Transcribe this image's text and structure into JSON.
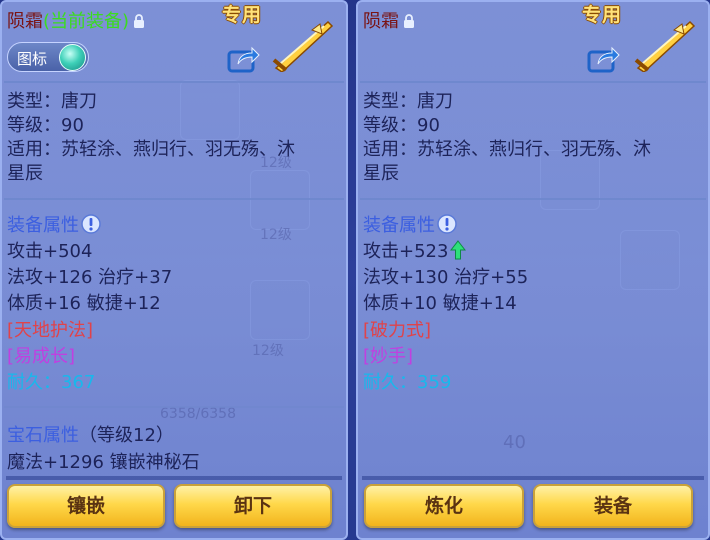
{
  "left_panel": {
    "name": "陨霜",
    "name_suffix": "(当前装备)",
    "exclusive": "专用",
    "toggle_label": "图标",
    "type": "类型：唐刀",
    "level": "等级：90",
    "usable_line1": "适用：苏轻涂、燕归行、羽无殇、沐",
    "usable_line2": "星辰",
    "attr_header": "装备属性",
    "attack": "攻击+504",
    "magic_heal": "法攻+126 治疗+37",
    "con_agi": "体质+16 敏捷+12",
    "skill1": "[天地护法]",
    "skill2": "[易成长]",
    "durability_label": "耐久：",
    "durability_value": "367",
    "gem_header": "宝石属性",
    "gem_level": "（等级12）",
    "gem_effect": "魔法+1296 镶嵌神秘石",
    "btn_left": "镶嵌",
    "btn_right": "卸下"
  },
  "right_panel": {
    "name": "陨霜",
    "exclusive": "专用",
    "type": "类型：唐刀",
    "level": "等级：90",
    "usable_line1": "适用：苏轻涂、燕归行、羽无殇、沐",
    "usable_line2": "星辰",
    "attr_header": "装备属性",
    "attack": "攻击+523",
    "magic_heal": "法攻+130 治疗+55",
    "con_agi": "体质+10 敏捷+14",
    "skill1": "[破力式]",
    "skill2": "[妙手]",
    "durability_label": "耐久：",
    "durability_value": "359",
    "btn_left": "炼化",
    "btn_right": "装备"
  },
  "background": {
    "bag_level_a": "12级",
    "bag_level_b": "12级",
    "bag_level_c": "12级",
    "hp_bar": "6358/6358",
    "count": "40"
  },
  "colors": {
    "panel": "#96aaeb",
    "name": "#7a1414",
    "current_tag": "#3bdc1e",
    "section": "#3c5fe0",
    "durability": "#18b8ec",
    "skill_red": "#e0434a",
    "skill_purple": "#c040e0",
    "button": "#ffd84a"
  }
}
